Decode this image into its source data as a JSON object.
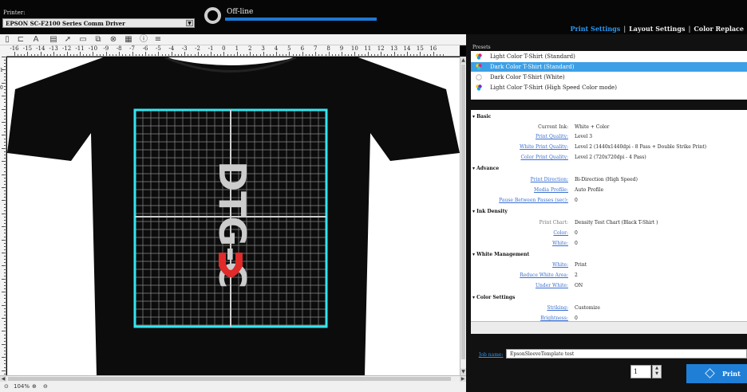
{
  "header": {
    "printer_label": "Printer:",
    "printer_value": "EPSON SC-F2100 Series Comm Driver",
    "status_text": "Off-line",
    "tabs": [
      "Print Settings",
      "Layout Settings",
      "Color Replace"
    ]
  },
  "ruler": {
    "top_labels": [
      "-16",
      "-15",
      "-14",
      "-13",
      "-12",
      "-11",
      "-10",
      "-9",
      "-8",
      "-7",
      "-6",
      "-5",
      "-4",
      "-3",
      "-2",
      "-1",
      "0",
      "1",
      "2",
      "3",
      "4",
      "5",
      "6",
      "7",
      "8",
      "9",
      "10",
      "11",
      "12",
      "13",
      "14",
      "15",
      "16"
    ],
    "left_labels": [
      "1",
      "0"
    ]
  },
  "canvas": {
    "artwork_text": "DTG-C",
    "grid_color": "#33e6f0",
    "shirt_color": "#0c0c0c"
  },
  "statusbar": {
    "zoom": "104%"
  },
  "presets": {
    "label": "Presets",
    "items": [
      {
        "label": "Light Color T-Shirt (Standard)",
        "selected": false
      },
      {
        "label": "Dark Color T-Shirt (Standard)",
        "selected": true
      },
      {
        "label": "Dark Color T-Shirt (White)",
        "selected": false
      },
      {
        "label": "Light Color T-Shirt (High Speed Color mode)",
        "selected": false
      }
    ]
  },
  "settings": {
    "basic_title": "Basic",
    "current_ink_label": "Current Ink:",
    "current_ink_value": "White + Color",
    "print_quality_label": "Print Quality:",
    "print_quality_value": "Level 3",
    "white_quality_label": "White Print Quality:",
    "white_quality_value": "Level 2 (1440x1440dpi - 8 Pass + Double Strike Print)",
    "color_quality_label": "Color Print Quality:",
    "color_quality_value": "Level 2 (720x720dpi - 4 Pass)",
    "advance_title": "Advance",
    "direction_label": "Print Direction:",
    "direction_value": "Bi-Direction (High Speed)",
    "media_label": "Media Profile:",
    "media_value": "Auto Profile",
    "pause_label": "Pause Between Passes (sec):",
    "pause_value": "0",
    "density_title": "Ink Density",
    "chart_label": "Print Chart:",
    "chart_value": "Density Test Chart (Black T-Shirt )",
    "color_label": "Color:",
    "color_value": "0",
    "white_label": "White:",
    "white_value": "0",
    "white_mgmt_title": "White Management",
    "wm_white_label": "White:",
    "wm_white_value": "Print",
    "reduce_label": "Reduce White Area:",
    "reduce_value": "2",
    "under_label": "Under White:",
    "under_value": "ON",
    "color_settings_title": "Color Settings",
    "striking_label": "Striking:",
    "striking_value": "Customize",
    "brightness_label": "Brightness:",
    "brightness_value": "0"
  },
  "job": {
    "label": "Job name:",
    "value": "EpsonSleeveTemplate test",
    "copies": "1",
    "print_label": "Print"
  }
}
